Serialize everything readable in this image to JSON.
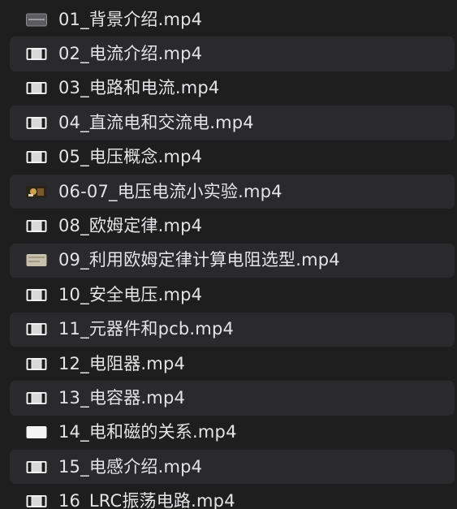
{
  "files": [
    {
      "name": "01_背景介绍.mp4",
      "thumb": "gray-thumbnail"
    },
    {
      "name": "02_电流介绍.mp4",
      "thumb": "video-file-icon"
    },
    {
      "name": "03_电路和电流.mp4",
      "thumb": "video-file-icon"
    },
    {
      "name": "04_直流电和交流电.mp4",
      "thumb": "video-file-icon"
    },
    {
      "name": "05_电压概念.mp4",
      "thumb": "video-file-icon"
    },
    {
      "name": "06-07_电压电流小实验.mp4",
      "thumb": "photo-thumbnail"
    },
    {
      "name": "08_欧姆定律.mp4",
      "thumb": "video-file-icon"
    },
    {
      "name": "09_利用欧姆定律计算电阻选型.mp4",
      "thumb": "beige-thumbnail"
    },
    {
      "name": "10_安全电压.mp4",
      "thumb": "video-file-icon"
    },
    {
      "name": "11_元器件和pcb.mp4",
      "thumb": "video-file-icon"
    },
    {
      "name": "12_电阻器.mp4",
      "thumb": "video-file-icon"
    },
    {
      "name": "13_电容器.mp4",
      "thumb": "video-file-icon"
    },
    {
      "name": "14_电和磁的关系.mp4",
      "thumb": "white-thumbnail"
    },
    {
      "name": "15_电感介绍.mp4",
      "thumb": "video-file-icon"
    },
    {
      "name": "16_LRC振荡电路.mp4",
      "thumb": "video-file-icon"
    }
  ],
  "colors": {
    "background": "#1e1e1f",
    "stripe": "#2a2a2c",
    "text": "#e4e4e6"
  }
}
